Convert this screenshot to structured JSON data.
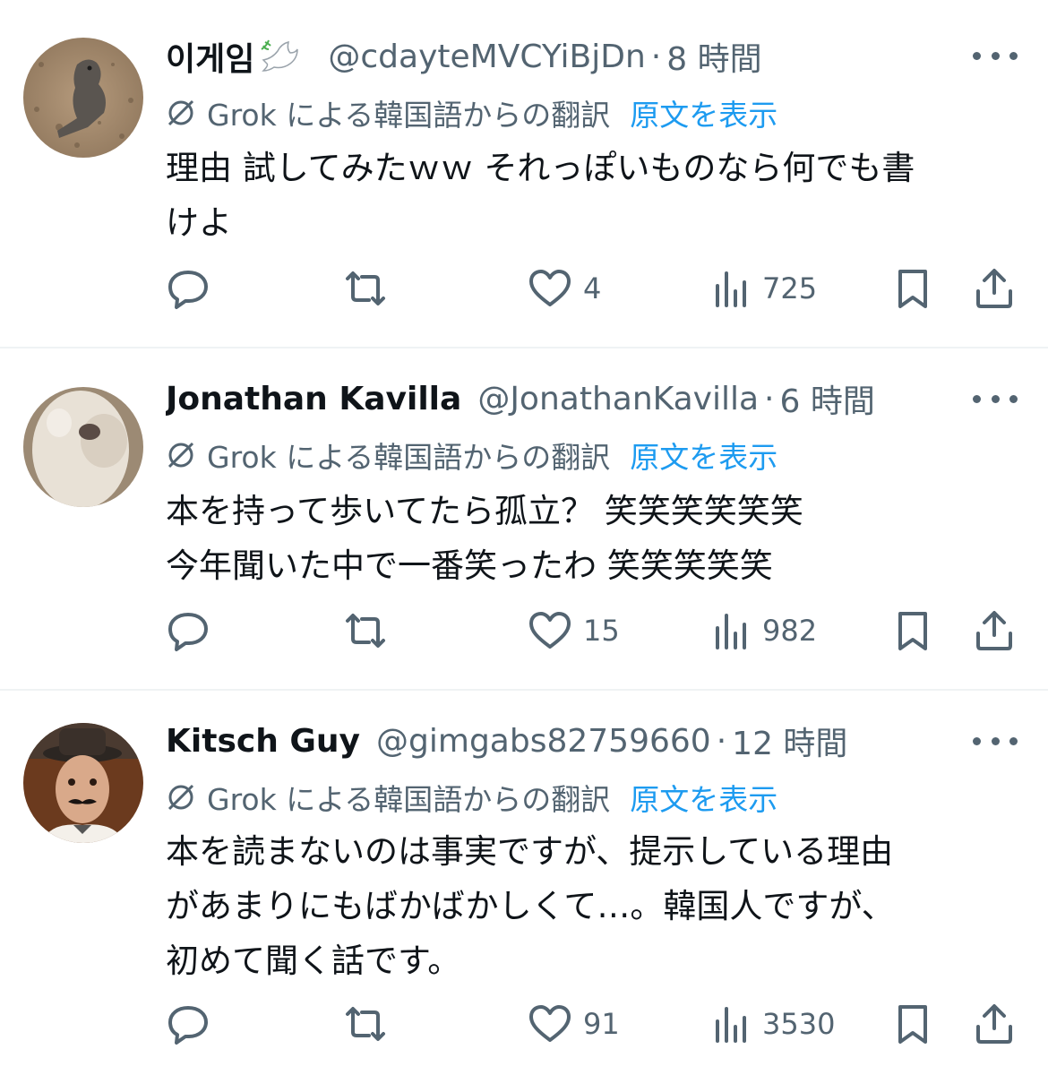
{
  "tweets": [
    {
      "name": "이게임",
      "has_dove": true,
      "handle": "@cdayteMVCYiBjDn",
      "sep": "·",
      "time": "8 時間",
      "translation_label": "Grok による韓国語からの翻訳",
      "show_original": "原文を表示",
      "body_lines": [
        "理由 試してみたｗｗ それっぽいものなら何でも書",
        "けよ"
      ],
      "likes": "4",
      "views": "725",
      "avatar_desc": "bird"
    },
    {
      "name": "Jonathan Kavilla",
      "has_dove": false,
      "handle": "@JonathanKavilla",
      "sep": "·",
      "time": "6 時間",
      "translation_label": "Grok による韓国語からの翻訳",
      "show_original": "原文を表示",
      "body_lines": [
        "本を持って歩いてたら孤立？ 笑笑笑笑笑笑",
        "今年聞いた中で一番笑ったわ 笑笑笑笑笑"
      ],
      "likes": "15",
      "views": "982",
      "avatar_desc": "dog"
    },
    {
      "name": "Kitsch Guy",
      "has_dove": false,
      "handle": "@gimgabs82759660",
      "sep": "·",
      "time": "12 時間",
      "translation_label": "Grok による韓国語からの翻訳",
      "show_original": "原文を表示",
      "body_lines": [
        "本を読まないのは事実ですが、提示している理由",
        "があまりにもばかばかしくて…。韓国人ですが、",
        "初めて聞く話です。"
      ],
      "likes": "91",
      "views": "3530",
      "avatar_desc": "man"
    }
  ],
  "colors": {
    "text": "#0f1419",
    "secondary": "#536471",
    "link": "#1d9bf0",
    "divider": "#eff3f4"
  }
}
